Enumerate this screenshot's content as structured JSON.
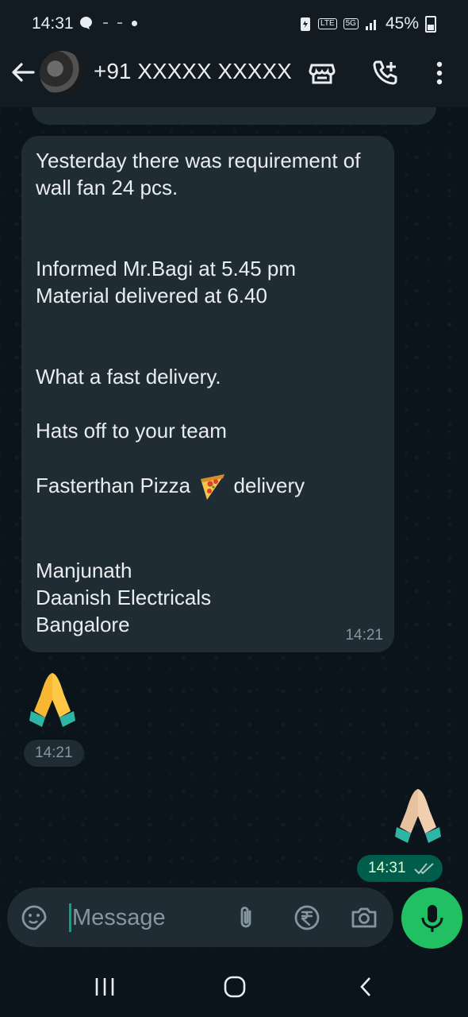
{
  "status_bar": {
    "time": "14:31",
    "battery": "45%",
    "network": "5G"
  },
  "header": {
    "title": "+91 XXXXX XXXXX"
  },
  "messages": {
    "incoming_text": "Yesterday there was requirement of wall fan 24 pcs.\n\n\nInformed Mr.Bagi at 5.45 pm\nMaterial delivered at 6.40\n\n\nWhat a fast delivery.\n\nHats off to your team\n\n",
    "pizza_line_before": "Fasterthan Pizza ",
    "pizza_line_after": " delivery",
    "signature": "\n\n\nManjunath\nDaanish Electricals\nBangalore",
    "incoming_time": "14:21",
    "incoming_emoji_time": "14:21",
    "outgoing_emoji_time": "14:31"
  },
  "composer": {
    "placeholder": "Message"
  },
  "colors": {
    "accent": "#21c063",
    "bubble_in": "#202c33",
    "bubble_out": "#005c4b",
    "background": "#0b141a"
  }
}
